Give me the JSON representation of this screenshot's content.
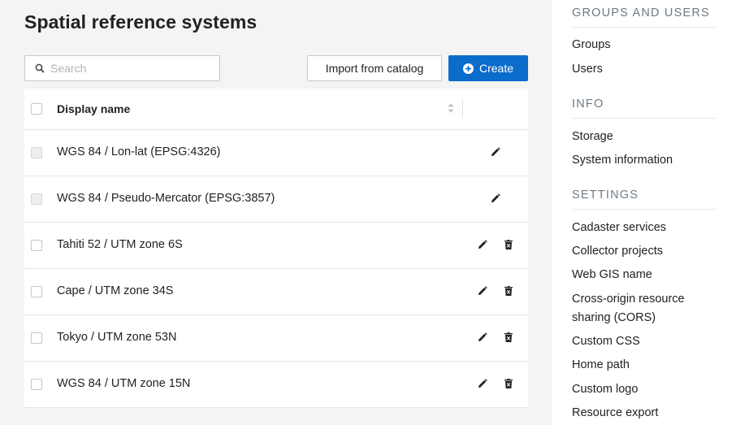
{
  "page": {
    "title": "Spatial reference systems"
  },
  "search": {
    "placeholder": "Search",
    "value": ""
  },
  "toolbar": {
    "import_label": "Import from catalog",
    "create_label": "Create"
  },
  "table": {
    "column_header": "Display name",
    "rows": [
      {
        "name": "WGS 84 / Lon-lat (EPSG:4326)",
        "deletable": false
      },
      {
        "name": "WGS 84 / Pseudo-Mercator (EPSG:3857)",
        "deletable": false
      },
      {
        "name": "Tahiti 52 / UTM zone 6S",
        "deletable": true
      },
      {
        "name": "Cape / UTM zone 34S",
        "deletable": true
      },
      {
        "name": "Tokyo / UTM zone 53N",
        "deletable": true
      },
      {
        "name": "WGS 84 / UTM zone 15N",
        "deletable": true
      }
    ]
  },
  "sidebar": {
    "sections": [
      {
        "title": "GROUPS AND USERS",
        "items": [
          "Groups",
          "Users"
        ]
      },
      {
        "title": "INFO",
        "items": [
          "Storage",
          "System information"
        ]
      },
      {
        "title": "SETTINGS",
        "items": [
          "Cadaster services",
          "Collector projects",
          "Web GIS name",
          "Cross-origin resource sharing (CORS)",
          "Custom CSS",
          "Home path",
          "Custom logo",
          "Resource export"
        ]
      }
    ]
  },
  "icons": {
    "search": "search-icon",
    "create": "plus-circle-icon",
    "sort": "sort-icon",
    "edit": "pencil-icon",
    "delete": "trash-icon"
  },
  "colors": {
    "primary": "#0a6ccb",
    "section_title": "#6f7a84"
  }
}
